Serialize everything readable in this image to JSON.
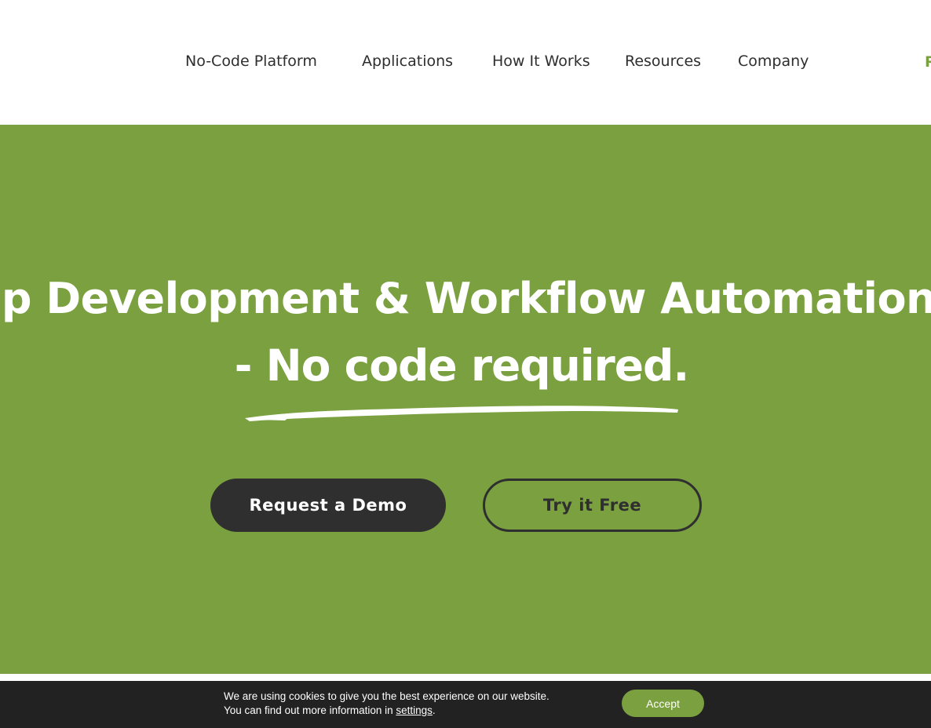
{
  "nav": {
    "items": [
      {
        "label": "No-Code Platform"
      },
      {
        "label": "Applications"
      },
      {
        "label": "How It Works"
      },
      {
        "label": "Resources"
      },
      {
        "label": "Company"
      }
    ],
    "cut_label": "R"
  },
  "hero": {
    "headline": "Web App Development & Workflow Automation",
    "subheadline": "- No code required.",
    "demo_button": "Request a Demo",
    "free_button": "Try it Free"
  },
  "cookie": {
    "line1": "We are using cookies to give you the best experience on our website.",
    "line2_prefix": "You can find out more information in ",
    "settings_link": "settings",
    "line2_suffix": ".",
    "accept_button": "Accept"
  },
  "colors": {
    "brand_green": "#7ba040",
    "dark": "#2f2f2f",
    "cookie_bg": "#222222"
  }
}
